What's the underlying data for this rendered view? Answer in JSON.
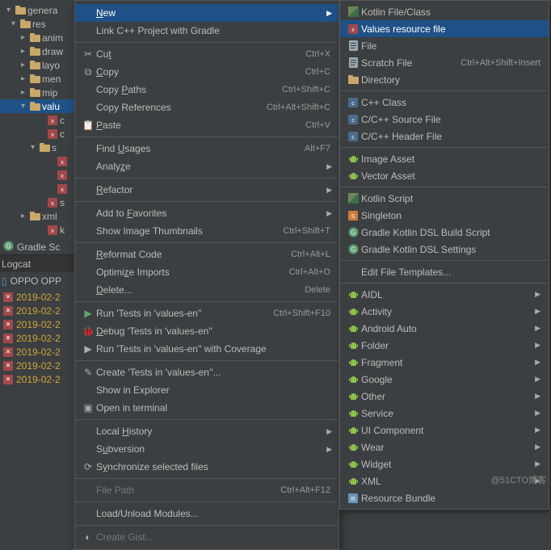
{
  "tree": {
    "items": [
      {
        "indent": 8,
        "exp": "▾",
        "icon": "folder",
        "label": "genera"
      },
      {
        "indent": 14,
        "exp": "▾",
        "icon": "folder",
        "label": "res"
      },
      {
        "indent": 26,
        "exp": "▸",
        "icon": "folder",
        "label": "anim"
      },
      {
        "indent": 26,
        "exp": "▸",
        "icon": "folder",
        "label": "draw"
      },
      {
        "indent": 26,
        "exp": "▸",
        "icon": "folder",
        "label": "layo"
      },
      {
        "indent": 26,
        "exp": "▸",
        "icon": "folder",
        "label": "men"
      },
      {
        "indent": 26,
        "exp": "▸",
        "icon": "folder",
        "label": "mip"
      },
      {
        "indent": 26,
        "exp": "▾",
        "icon": "folder",
        "label": "valu",
        "hl": true
      },
      {
        "indent": 48,
        "exp": "",
        "icon": "xml",
        "label": "c"
      },
      {
        "indent": 48,
        "exp": "",
        "icon": "xml",
        "label": "c"
      },
      {
        "indent": 38,
        "exp": "▾",
        "icon": "folder",
        "label": "s"
      },
      {
        "indent": 60,
        "exp": "",
        "icon": "xml",
        "label": ""
      },
      {
        "indent": 60,
        "exp": "",
        "icon": "xml",
        "label": ""
      },
      {
        "indent": 60,
        "exp": "",
        "icon": "xml",
        "label": ""
      },
      {
        "indent": 48,
        "exp": "",
        "icon": "xml",
        "label": "s"
      },
      {
        "indent": 26,
        "exp": "▸",
        "icon": "folder",
        "label": "xml"
      },
      {
        "indent": 48,
        "exp": "",
        "icon": "xml",
        "label": "k"
      }
    ]
  },
  "gradle_label": "Gradle Sc",
  "logcat_label": "Logcat",
  "device_label": "OPPO OPP",
  "logs": [
    "2019-02-2",
    "2019-02-2",
    "2019-02-2",
    "2019-02-2",
    "2019-02-2",
    "2019-02-2",
    "2019-02-2"
  ],
  "menu": [
    {
      "icon": "",
      "label": "New",
      "mn": "N",
      "sc": "",
      "arrow": true,
      "hl": true
    },
    {
      "icon": "",
      "label": "Link C++ Project with Gradle",
      "sc": ""
    },
    {
      "sep": true
    },
    {
      "icon": "✂",
      "label": "Cut",
      "mn": "t",
      "sc": "Ctrl+X"
    },
    {
      "icon": "⧉",
      "label": "Copy",
      "mn": "C",
      "sc": "Ctrl+C"
    },
    {
      "icon": "",
      "label": "Copy Paths",
      "mn": "P",
      "sc": "Ctrl+Shift+C"
    },
    {
      "icon": "",
      "label": "Copy References",
      "sc": "Ctrl+Alt+Shift+C"
    },
    {
      "icon": "📋",
      "label": "Paste",
      "mn": "P",
      "sc": "Ctrl+V"
    },
    {
      "sep": true
    },
    {
      "icon": "",
      "label": "Find Usages",
      "mn": "U",
      "sc": "Alt+F7"
    },
    {
      "icon": "",
      "label": "Analyze",
      "mn": "z",
      "arrow": true
    },
    {
      "sep": true
    },
    {
      "icon": "",
      "label": "Refactor",
      "mn": "R",
      "arrow": true
    },
    {
      "sep": true
    },
    {
      "icon": "",
      "label": "Add to Favorites",
      "mn": "F",
      "arrow": true
    },
    {
      "icon": "",
      "label": "Show Image Thumbnails",
      "sc": "Ctrl+Shift+T"
    },
    {
      "sep": true
    },
    {
      "icon": "",
      "label": "Reformat Code",
      "mn": "R",
      "sc": "Ctrl+Alt+L"
    },
    {
      "icon": "",
      "label": "Optimize Imports",
      "mn": "z",
      "sc": "Ctrl+Alt+O"
    },
    {
      "icon": "",
      "label": "Delete...",
      "mn": "D",
      "sc": "Delete"
    },
    {
      "sep": true
    },
    {
      "icon": "▶",
      "label": "Run 'Tests in 'values-en''",
      "sc": "Ctrl+Shift+F10",
      "green": true
    },
    {
      "icon": "🐞",
      "label": "Debug 'Tests in 'values-en''",
      "mn": "D"
    },
    {
      "icon": "▶",
      "label": "Run 'Tests in 'values-en'' with Coverage"
    },
    {
      "sep": true
    },
    {
      "icon": "✎",
      "label": "Create 'Tests in 'values-en''..."
    },
    {
      "icon": "",
      "label": "Show in Explorer"
    },
    {
      "icon": "▣",
      "label": "Open in terminal"
    },
    {
      "sep": true
    },
    {
      "icon": "",
      "label": "Local History",
      "mn": "H",
      "arrow": true
    },
    {
      "icon": "",
      "label": "Subversion",
      "mn": "u",
      "arrow": true
    },
    {
      "icon": "⟳",
      "label": "Synchronize selected files",
      "mn": "y"
    },
    {
      "sep": true
    },
    {
      "icon": "",
      "label": "File Path",
      "sc": "Ctrl+Alt+F12",
      "disabled": true
    },
    {
      "sep": true
    },
    {
      "icon": "",
      "label": "Load/Unload Modules..."
    },
    {
      "sep": true
    },
    {
      "icon": "◐",
      "label": "Create Gist...",
      "disabled": true
    }
  ],
  "submenu": [
    {
      "icon": "kt",
      "label": "Kotlin File/Class"
    },
    {
      "icon": "xml",
      "label": "Values resource file",
      "hl": true
    },
    {
      "icon": "file",
      "label": "File"
    },
    {
      "icon": "file",
      "label": "Scratch File",
      "sc": "Ctrl+Alt+Shift+Insert"
    },
    {
      "icon": "folder",
      "label": "Directory"
    },
    {
      "sep": true
    },
    {
      "icon": "cpp",
      "label": "C++ Class"
    },
    {
      "icon": "cpp",
      "label": "C/C++ Source File"
    },
    {
      "icon": "cpp",
      "label": "C/C++ Header File"
    },
    {
      "sep": true
    },
    {
      "icon": "android",
      "label": "Image Asset"
    },
    {
      "icon": "android",
      "label": "Vector Asset"
    },
    {
      "sep": true
    },
    {
      "icon": "kt",
      "label": "Kotlin Script"
    },
    {
      "icon": "sg",
      "label": "Singleton"
    },
    {
      "icon": "gradle",
      "label": "Gradle Kotlin DSL Build Script"
    },
    {
      "icon": "gradle",
      "label": "Gradle Kotlin DSL Settings"
    },
    {
      "sep": true
    },
    {
      "icon": "",
      "label": "Edit File Templates..."
    },
    {
      "sep": true
    },
    {
      "icon": "android",
      "label": "AIDL",
      "arrow": true
    },
    {
      "icon": "android",
      "label": "Activity",
      "arrow": true
    },
    {
      "icon": "android",
      "label": "Android Auto",
      "arrow": true
    },
    {
      "icon": "android",
      "label": "Folder",
      "arrow": true
    },
    {
      "icon": "android",
      "label": "Fragment",
      "arrow": true
    },
    {
      "icon": "android",
      "label": "Google",
      "arrow": true
    },
    {
      "icon": "android",
      "label": "Other",
      "arrow": true
    },
    {
      "icon": "android",
      "label": "Service",
      "arrow": true
    },
    {
      "icon": "android",
      "label": "UI Component",
      "arrow": true
    },
    {
      "icon": "android",
      "label": "Wear",
      "arrow": true
    },
    {
      "icon": "android",
      "label": "Widget",
      "arrow": true
    },
    {
      "icon": "android",
      "label": "XML",
      "arrow": true
    },
    {
      "icon": "res",
      "label": "Resource Bundle"
    }
  ],
  "watermark": "@51CTO博客"
}
